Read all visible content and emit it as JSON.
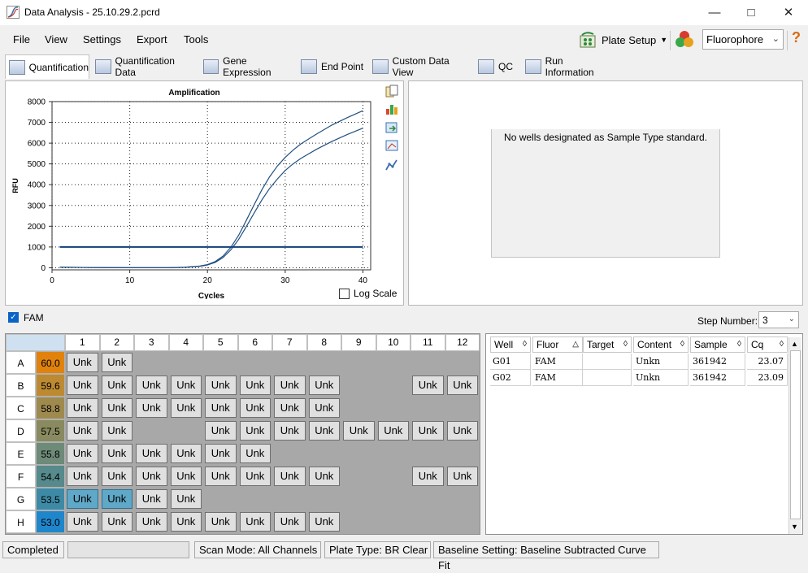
{
  "window": {
    "title": "Data Analysis - 25.10.29.2.pcrd"
  },
  "menu": [
    "File",
    "View",
    "Settings",
    "Export",
    "Tools"
  ],
  "toolbar": {
    "plate_setup": "Plate Setup",
    "fluorophore": "Fluorophore"
  },
  "tabs": [
    "Quantification",
    "Quantification Data",
    "Gene Expression",
    "End Point",
    "Custom Data View",
    "QC",
    "Run Information"
  ],
  "chart_data": {
    "type": "line",
    "title": "Amplification",
    "xlabel": "Cycles",
    "ylabel": "RFU",
    "xlim": [
      0,
      41
    ],
    "ylim": [
      -100,
      8000
    ],
    "xticks": [
      0,
      10,
      20,
      30,
      40
    ],
    "yticks": [
      0,
      1000,
      2000,
      3000,
      4000,
      5000,
      6000,
      7000,
      8000
    ],
    "grid": true,
    "threshold": 1000,
    "series": [
      {
        "x": [
          1,
          5,
          10,
          15,
          17,
          19,
          20,
          21,
          22,
          23,
          24,
          25,
          26,
          27,
          28,
          29,
          30,
          31,
          32,
          34,
          36,
          38,
          40
        ],
        "y": [
          30,
          10,
          0,
          0,
          20,
          80,
          150,
          300,
          560,
          980,
          1560,
          2280,
          3030,
          3750,
          4380,
          4900,
          5310,
          5660,
          5960,
          6430,
          6870,
          7230,
          7560
        ]
      },
      {
        "x": [
          1,
          5,
          10,
          15,
          17,
          19,
          20,
          21,
          22,
          23,
          24,
          25,
          26,
          27,
          28,
          29,
          30,
          31,
          32,
          34,
          36,
          38,
          40
        ],
        "y": [
          30,
          10,
          0,
          0,
          20,
          70,
          130,
          260,
          490,
          860,
          1360,
          1980,
          2630,
          3260,
          3820,
          4280,
          4680,
          5000,
          5260,
          5700,
          6080,
          6420,
          6720
        ]
      }
    ]
  },
  "log_scale_label": "Log Scale",
  "standard_curve_message": "No wells designated as Sample Type standard.",
  "fluor_filter": {
    "label": "FAM",
    "checked": true
  },
  "step": {
    "label": "Step Number:",
    "value": "3"
  },
  "plate": {
    "columns": [
      "1",
      "2",
      "3",
      "4",
      "5",
      "6",
      "7",
      "8",
      "9",
      "10",
      "11",
      "12"
    ],
    "rows": [
      {
        "label": "A",
        "temp": "60.0",
        "temp_color": "#e0820c",
        "wells": [
          "Unk",
          "Unk",
          "",
          "",
          "",
          "",
          "",
          "",
          "",
          "",
          "",
          ""
        ]
      },
      {
        "label": "B",
        "temp": "59.6",
        "temp_color": "#bd8a32",
        "wells": [
          "Unk",
          "Unk",
          "Unk",
          "Unk",
          "Unk",
          "Unk",
          "Unk",
          "Unk",
          "",
          "",
          "Unk",
          "Unk"
        ]
      },
      {
        "label": "C",
        "temp": "58.8",
        "temp_color": "#9f8a4e",
        "wells": [
          "Unk",
          "Unk",
          "Unk",
          "Unk",
          "Unk",
          "Unk",
          "Unk",
          "Unk",
          "",
          "",
          "",
          ""
        ]
      },
      {
        "label": "D",
        "temp": "57.5",
        "temp_color": "#898a5f",
        "wells": [
          "Unk",
          "Unk",
          "",
          "",
          "Unk",
          "Unk",
          "Unk",
          "Unk",
          "Unk",
          "Unk",
          "Unk",
          "Unk"
        ]
      },
      {
        "label": "E",
        "temp": "55.8",
        "temp_color": "#6e8a78",
        "wells": [
          "Unk",
          "Unk",
          "Unk",
          "Unk",
          "Unk",
          "Unk",
          "",
          "",
          "",
          "",
          "",
          ""
        ]
      },
      {
        "label": "F",
        "temp": "54.4",
        "temp_color": "#568a8c",
        "wells": [
          "Unk",
          "Unk",
          "Unk",
          "Unk",
          "Unk",
          "Unk",
          "Unk",
          "Unk",
          "",
          "",
          "Unk",
          "Unk"
        ]
      },
      {
        "label": "G",
        "temp": "53.5",
        "temp_color": "#3d8aa6",
        "wells": [
          "Unk",
          "Unk",
          "Unk",
          "Unk",
          "",
          "",
          "",
          "",
          "",
          "",
          "",
          ""
        ]
      },
      {
        "label": "H",
        "temp": "53.0",
        "temp_color": "#1f86cc",
        "wells": [
          "Unk",
          "Unk",
          "Unk",
          "Unk",
          "Unk",
          "Unk",
          "Unk",
          "Unk",
          "",
          "",
          "",
          ""
        ]
      }
    ],
    "selected": [
      "G1",
      "G2"
    ]
  },
  "results_table": {
    "headers": [
      "Well",
      "Fluor",
      "Target",
      "Content",
      "Sample",
      "Cq"
    ],
    "rows": [
      [
        "G01",
        "FAM",
        "",
        "Unkn",
        "361942",
        "23.07"
      ],
      [
        "G02",
        "FAM",
        "",
        "Unkn",
        "361942",
        "23.09"
      ]
    ]
  },
  "status": [
    "Completed",
    "",
    "Scan Mode: All Channels",
    "Plate Type: BR Clear",
    "Baseline Setting: Baseline Subtracted Curve Fit"
  ]
}
